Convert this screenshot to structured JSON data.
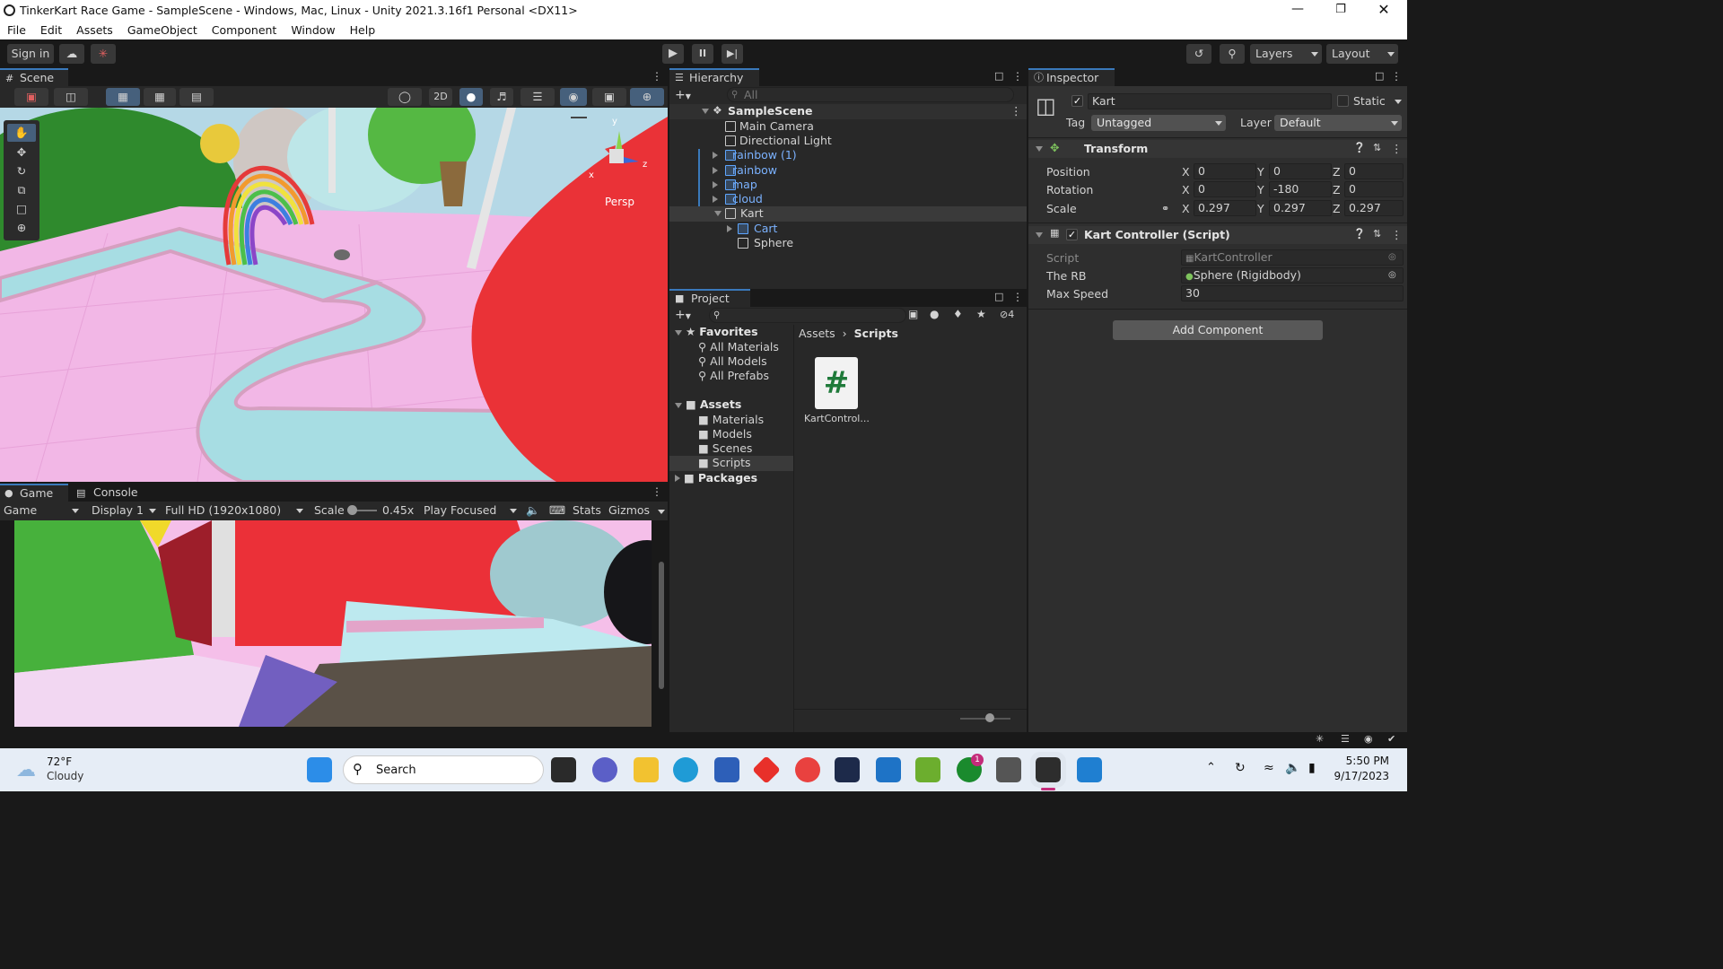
{
  "window": {
    "title": "TinkerKart Race Game - SampleScene - Windows, Mac, Linux - Unity 2021.3.16f1 Personal <DX11>"
  },
  "menu": [
    "File",
    "Edit",
    "Assets",
    "GameObject",
    "Component",
    "Window",
    "Help"
  ],
  "toolbar": {
    "sign_in": "Sign in",
    "layers": "Layers",
    "layout": "Layout"
  },
  "scene": {
    "tab": "Scene",
    "mode_2d": "2D",
    "persp": "Persp",
    "gizmo_y": "y",
    "gizmo_x": "x",
    "gizmo_z": "z"
  },
  "game": {
    "tab_game": "Game",
    "tab_console": "Console",
    "view": "Game",
    "display": "Display 1",
    "resolution": "Full HD (1920x1080)",
    "scale_label": "Scale",
    "scale_value": "0.45x",
    "play_mode": "Play Focused",
    "stats": "Stats",
    "gizmos": "Gizmos",
    "scale_fraction": 0.12
  },
  "hierarchy": {
    "tab": "Hierarchy",
    "search_placeholder": "All",
    "scene": "SampleScene",
    "items": [
      {
        "label": "Main Camera"
      },
      {
        "label": "Directional Light"
      },
      {
        "label": "rainbow (1)"
      },
      {
        "label": "rainbow"
      },
      {
        "label": "map"
      },
      {
        "label": "cloud"
      },
      {
        "label": "Kart"
      },
      {
        "label": "Cart"
      },
      {
        "label": "Sphere"
      }
    ]
  },
  "project": {
    "tab": "Project",
    "hidden_count": "4",
    "favorites": "Favorites",
    "fav_items": [
      "All Materials",
      "All Models",
      "All Prefabs"
    ],
    "assets": "Assets",
    "asset_folders": [
      "Materials",
      "Models",
      "Scenes",
      "Scripts"
    ],
    "packages": "Packages",
    "breadcrumb_root": "Assets",
    "breadcrumb_current": "Scripts",
    "file_name": "KartControl..."
  },
  "inspector": {
    "tab": "Inspector",
    "object_name": "Kart",
    "static_label": "Static",
    "tag_label": "Tag",
    "tag_value": "Untagged",
    "layer_label": "Layer",
    "layer_value": "Default",
    "transform": {
      "title": "Transform",
      "position_label": "Position",
      "rotation_label": "Rotation",
      "scale_label": "Scale",
      "axis_x": "X",
      "axis_y": "Y",
      "axis_z": "Z",
      "position": [
        "0",
        "0",
        "0"
      ],
      "rotation": [
        "0",
        "-180",
        "0"
      ],
      "scale": [
        "0.297",
        "0.297",
        "0.297"
      ]
    },
    "kart_controller": {
      "title": "Kart Controller (Script)",
      "script_label": "Script",
      "script_value": "KartController",
      "rb_label": "The RB",
      "rb_value": "Sphere (Rigidbody)",
      "speed_label": "Max Speed",
      "speed_value": "30"
    },
    "add_component": "Add Component"
  },
  "taskbar": {
    "weather_temp": "72°F",
    "weather_desc": "Cloudy",
    "search": "Search",
    "badge": "1",
    "time": "5:50 PM",
    "date": "9/17/2023"
  }
}
